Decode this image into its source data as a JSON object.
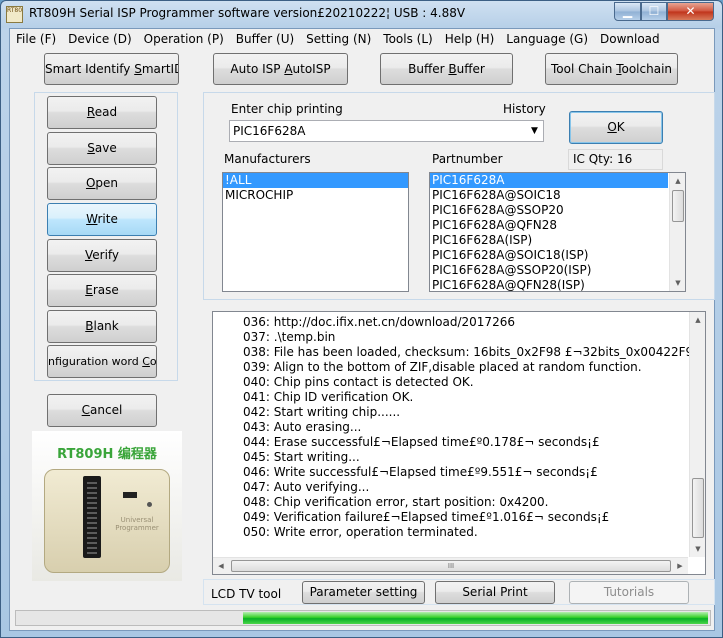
{
  "window": {
    "title": "RT809H Serial ISP Programmer software version£20210222¦ USB : 4.88V",
    "icon_text": "RT809H",
    "minimize_glyph": "▁",
    "maximize_glyph": "☐",
    "close_glyph": "✕"
  },
  "menu": [
    "File (F)",
    "Device (D)",
    "Operation (P)",
    "Buffer (U)",
    "Setting (N)",
    "Tools (L)",
    "Help (H)",
    "Language (G)",
    "Download"
  ],
  "toolbar": {
    "smart_identify": "Smart Identify ",
    "smart_identify_u": "S",
    "smart_identify_rest": "martID",
    "auto_isp": "Auto ISP ",
    "auto_isp_u": "A",
    "auto_isp_rest": "utoISP",
    "buffer": "Buffer ",
    "buffer_u": "B",
    "buffer_rest": "uffer",
    "tool_chain": "Tool Chain ",
    "tool_chain_u": "T",
    "tool_chain_rest": "oolchain"
  },
  "actions": {
    "read_u": "R",
    "read_rest": "ead",
    "save_u": "S",
    "save_rest": "ave",
    "open_u": "O",
    "open_rest": "pen",
    "write_u": "W",
    "write_rest": "rite",
    "verify_u": "V",
    "verify_rest": "erify",
    "erase_u": "E",
    "erase_rest": "rase",
    "blank_u": "B",
    "blank_rest": "lank",
    "config_word": "nfiguration word ",
    "config_word_u": "C",
    "config_word_rest": "or",
    "cancel_u": "C",
    "cancel_rest": "ancel"
  },
  "device_image": {
    "caption": "RT809H 编程器",
    "body_text": "Universal Programmer"
  },
  "chip": {
    "enter_label": "Enter chip printing",
    "history_label": "History",
    "value": "PIC16F628A",
    "ok_u": "O",
    "ok_rest": "K",
    "manufacturers_label": "Manufacturers",
    "partnumber_label": "Partnumber",
    "ic_qty": "IC Qty: 16",
    "manufacturers": [
      "!ALL",
      "MICROCHIP"
    ],
    "partnumbers": [
      "PIC16F628A",
      "PIC16F628A@SOIC18",
      "PIC16F628A@SSOP20",
      "PIC16F628A@QFN28",
      "PIC16F628A(ISP)",
      "PIC16F628A@SOIC18(ISP)",
      "PIC16F628A@SSOP20(ISP)",
      "PIC16F628A@QFN28(ISP)"
    ]
  },
  "log": [
    "036:  http://doc.ifix.net.cn/download/2017266",
    "037:  .\\temp.bin",
    "038:  File has been loaded, checksum: 16bits_0x2F98 £¬32bits_0x00422F98 :",
    "039:  Align to the bottom of ZIF,disable placed at random function.",
    "040:  Chip pins contact is detected OK.",
    "041:  Chip ID verification OK.",
    "042:  Start writing chip......",
    "043:  Auto erasing...",
    "044:  Erase successful£¬Elapsed time£º0.178£¬ seconds¡£",
    "045:  Start writing...",
    "046:  Write successful£¬Elapsed time£º9.551£¬ seconds¡£",
    "047:  Auto verifying...",
    "048:  Chip verification error, start position: 0x4200.",
    "049:  Verification failure£¬Elapsed time£º1.016£¬ seconds¡£",
    "050:  Write error, operation terminated."
  ],
  "hscroll_grip": "III",
  "bottom": {
    "lcd_tool": "LCD TV tool",
    "parameter_setting": "Parameter setting",
    "serial_print": "Serial Print",
    "tutorials": "Tutorials"
  },
  "progress": {
    "value": 0.67
  }
}
